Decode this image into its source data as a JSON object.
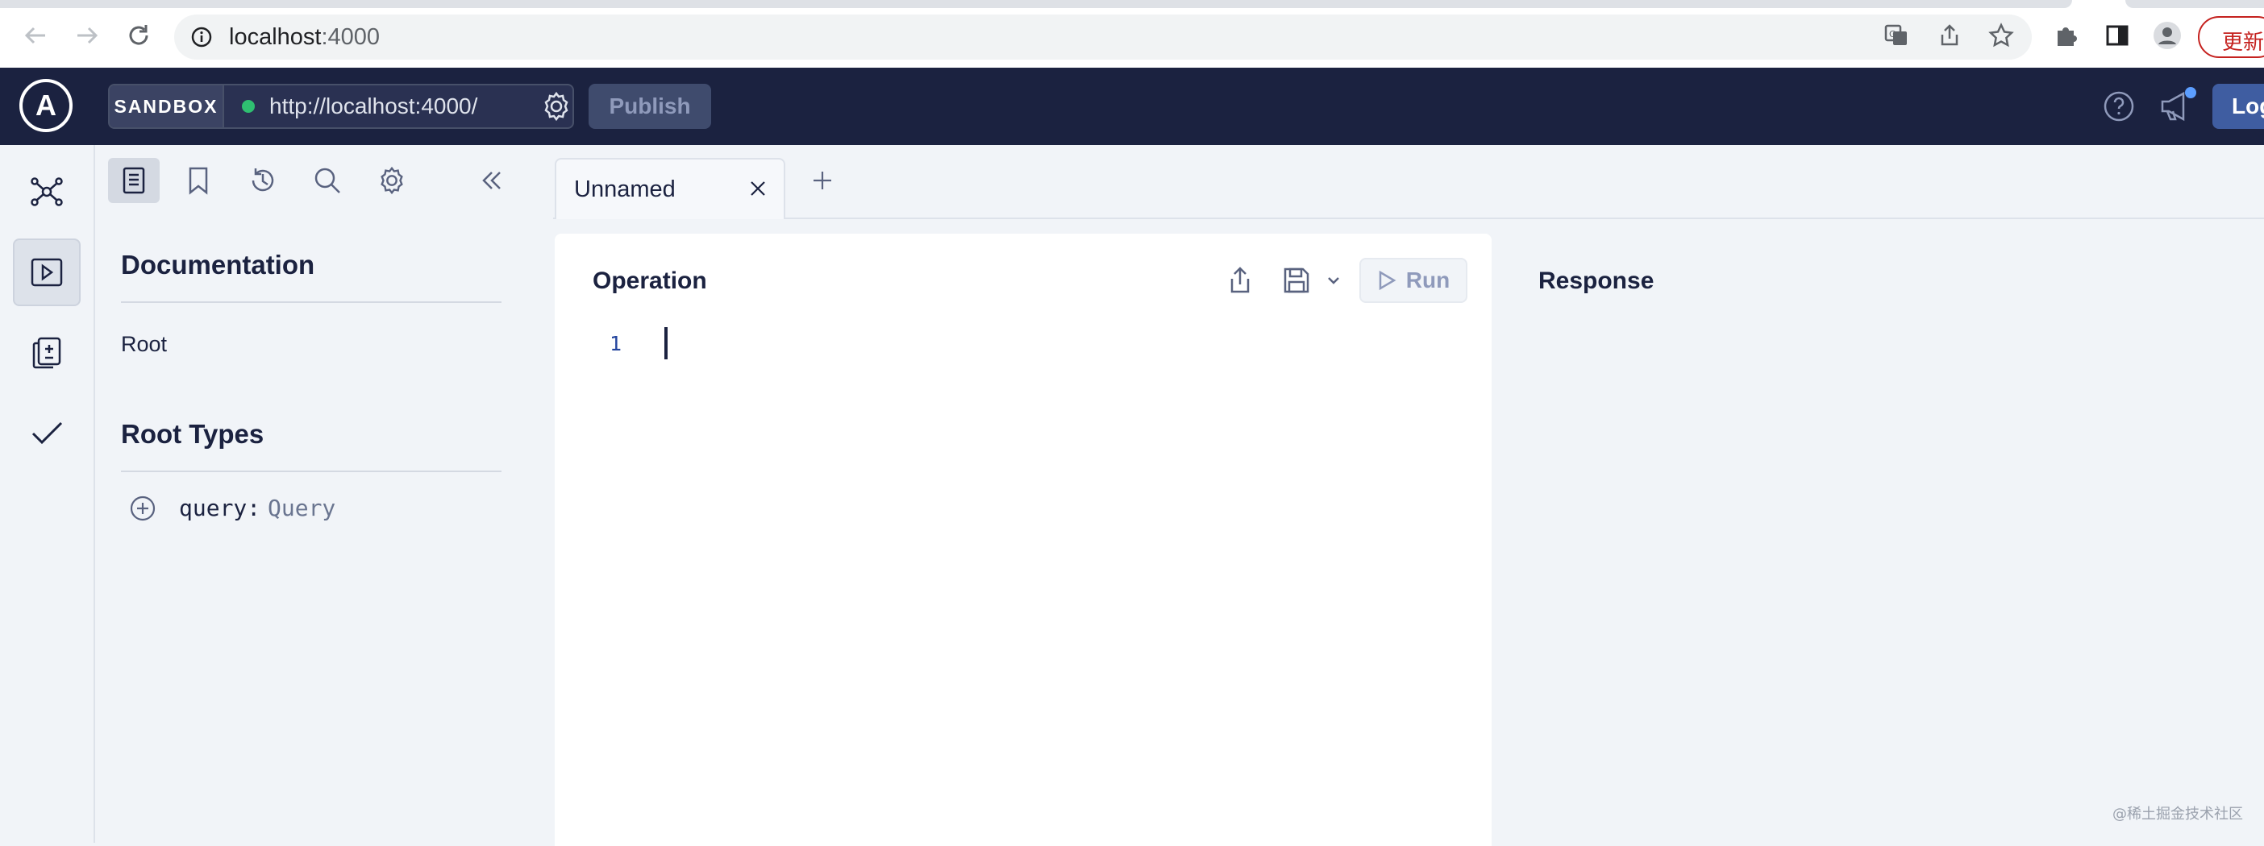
{
  "browser": {
    "url_host": "localhost",
    "url_port": ":4000",
    "update_label": "更新"
  },
  "header": {
    "logo_letter": "A",
    "sandbox_label": "SANDBOX",
    "endpoint_url": "http://localhost:4000/",
    "publish_label": "Publish",
    "login_label": "Log"
  },
  "docs": {
    "title": "Documentation",
    "root_link": "Root",
    "root_types_title": "Root Types",
    "fields": [
      {
        "name": "query:",
        "type": "Query"
      }
    ]
  },
  "tabs": [
    {
      "label": "Unnamed"
    }
  ],
  "operation": {
    "title": "Operation",
    "run_label": "Run",
    "line_numbers": [
      "1"
    ]
  },
  "response": {
    "title": "Response"
  },
  "watermark": "@稀土掘金技术社区",
  "colors": {
    "header_bg": "#1b2240",
    "status_online": "#2fbf71",
    "notification_dot": "#5c9eff",
    "login_bg": "#3f5da1",
    "line_number": "#24459e"
  }
}
